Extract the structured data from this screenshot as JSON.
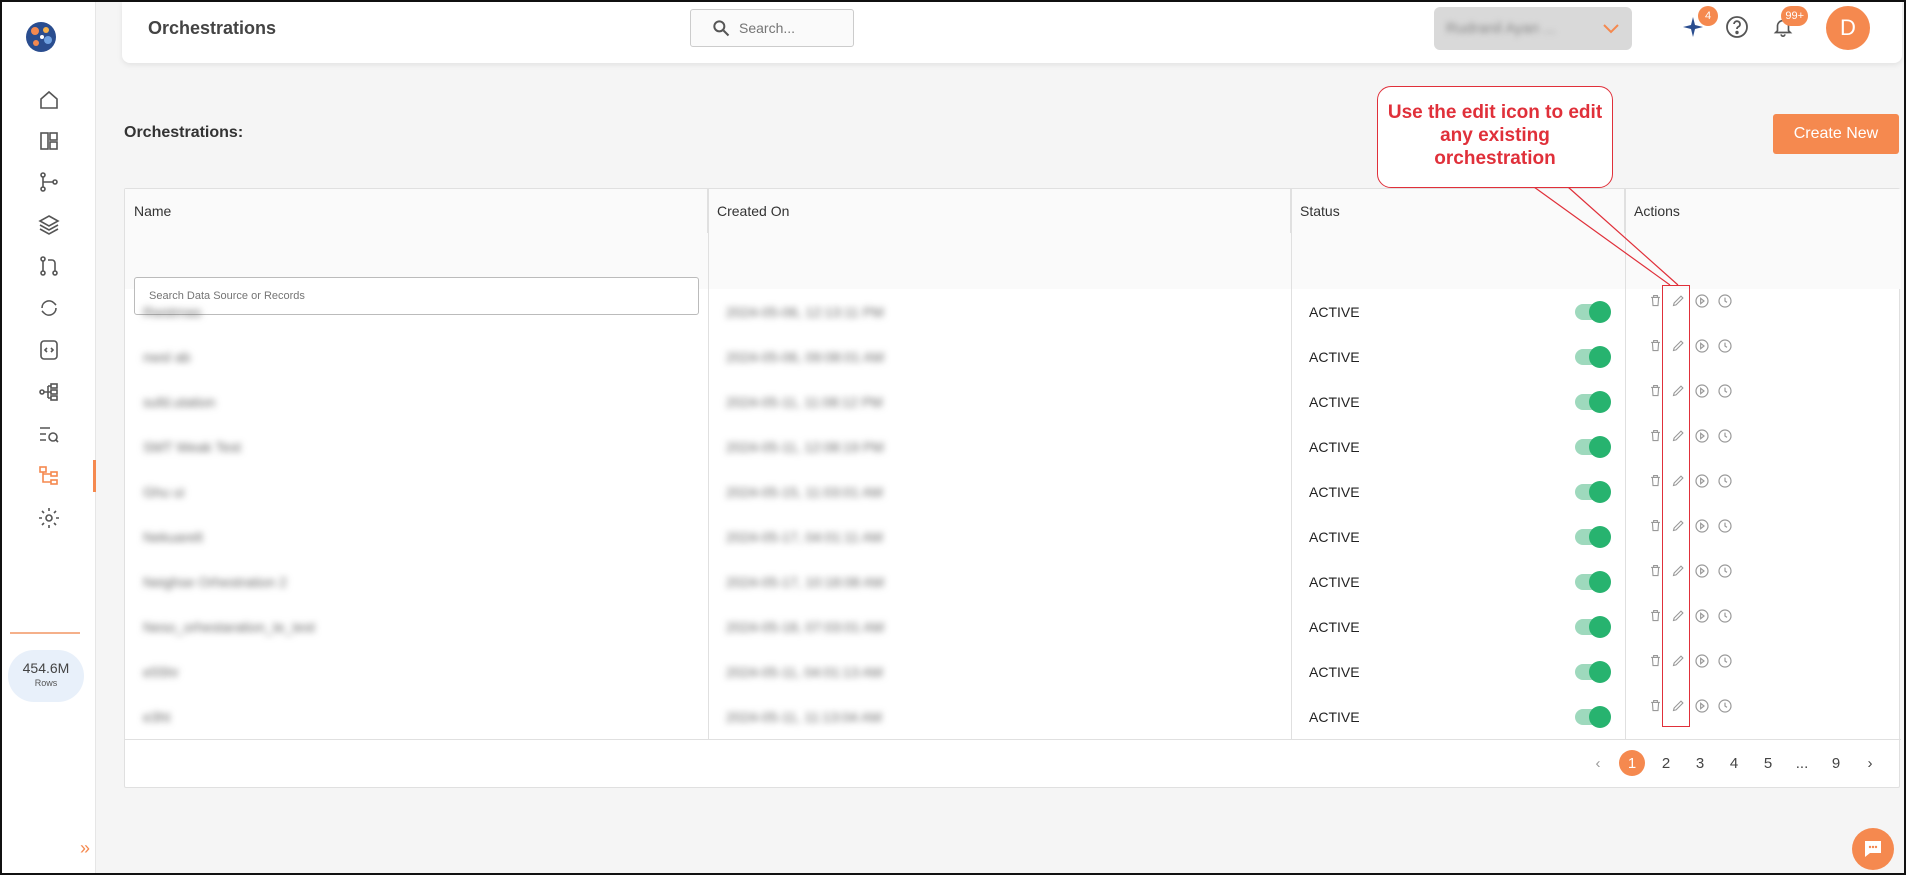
{
  "header": {
    "title": "Orchestrations",
    "search_placeholder": "Search...",
    "account_name": "Rudranil Ayan ...",
    "sparkle_badge": "4",
    "notifications_badge": "99+",
    "avatar_letter": "D"
  },
  "sidebar": {
    "rows_value": "454.6M",
    "rows_label": "Rows",
    "expand_glyph": "»"
  },
  "main": {
    "heading": "Orchestrations:",
    "create_label": "Create New"
  },
  "table": {
    "columns": [
      "Name",
      "Created On",
      "Status",
      "Actions"
    ],
    "filter_placeholder": "Search Data Source or Records",
    "rows": [
      {
        "name": "Rwstrnas",
        "created": "2024-05-06, 12:13:11 PM",
        "status": "ACTIVE"
      },
      {
        "name": "nwsl ab",
        "created": "2024-05-06, 09:08:01 AM",
        "status": "ACTIVE"
      },
      {
        "name": "sufd.utation",
        "created": "2024-05-11, 11:08:12 PM",
        "status": "ACTIVE"
      },
      {
        "name": "SMT Weak Test",
        "created": "2024-05-11, 12:08:19 PM",
        "status": "ACTIVE"
      },
      {
        "name": "Ghu ui",
        "created": "2024-05-15, 11:03:01 AM",
        "status": "ACTIVE"
      },
      {
        "name": "Nekuarelt",
        "created": "2024-05-17, 04:01:11 AM",
        "status": "ACTIVE"
      },
      {
        "name": "Neighse Orhestration 2",
        "created": "2024-05-17, 10:18:08 AM",
        "status": "ACTIVE"
      },
      {
        "name": "Neso_orhestaration_te_test",
        "created": "2024-05-18, 07:03:01 AM",
        "status": "ACTIVE"
      },
      {
        "name": "e55hr",
        "created": "2024-05-11, 04:01:13 AM",
        "status": "ACTIVE"
      },
      {
        "name": "e3ht",
        "created": "2024-05-11, 11:13:04 AM",
        "status": "ACTIVE"
      }
    ]
  },
  "pagination": {
    "prev": "‹",
    "pages": [
      "1",
      "2",
      "3",
      "4",
      "5",
      "...",
      "9"
    ],
    "active": "1",
    "next": "›"
  },
  "annotation": {
    "text": "Use the edit icon to edit any existing orchestration"
  },
  "colors": {
    "accent": "#f5894f",
    "toggle_on": "#27b36f",
    "annotation": "#e0303a"
  }
}
